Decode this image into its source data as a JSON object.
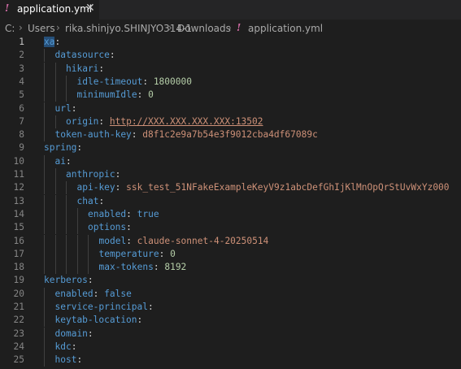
{
  "tab": {
    "icon": "yaml-icon",
    "label": "application.yml",
    "close": "✕"
  },
  "breadcrumb": {
    "items": [
      "C:",
      "Users",
      "rika.shinjyo.SHINJYO314-1",
      "Downloads"
    ],
    "file_icon": "!",
    "file": "application.yml"
  },
  "lines": [
    {
      "n": "1",
      "indent": 0,
      "key": "xa",
      "sep": ":",
      "val": "",
      "vt": ""
    },
    {
      "n": "2",
      "indent": 1,
      "key": "datasource",
      "sep": ":",
      "val": "",
      "vt": ""
    },
    {
      "n": "3",
      "indent": 2,
      "key": "hikari",
      "sep": ":",
      "val": "",
      "vt": ""
    },
    {
      "n": "4",
      "indent": 3,
      "key": "idle-timeout",
      "sep": ": ",
      "val": "1800000",
      "vt": "n"
    },
    {
      "n": "5",
      "indent": 3,
      "key": "minimumIdle",
      "sep": ": ",
      "val": "0",
      "vt": "n"
    },
    {
      "n": "6",
      "indent": 1,
      "key": "url",
      "sep": ":",
      "val": "",
      "vt": ""
    },
    {
      "n": "7",
      "indent": 2,
      "key": "origin",
      "sep": ": ",
      "val": "http://XXX.XXX.XXX.XXX:13502",
      "vt": "su"
    },
    {
      "n": "8",
      "indent": 1,
      "key": "token-auth-key",
      "sep": ": ",
      "val": "d8f1c2e9a7b54e3f9012cba4df67089c",
      "vt": "s"
    },
    {
      "n": "9",
      "indent": 0,
      "key": "spring",
      "sep": ":",
      "val": "",
      "vt": ""
    },
    {
      "n": "10",
      "indent": 1,
      "key": "ai",
      "sep": ":",
      "val": "",
      "vt": ""
    },
    {
      "n": "11",
      "indent": 2,
      "key": "anthropic",
      "sep": ":",
      "val": "",
      "vt": ""
    },
    {
      "n": "12",
      "indent": 3,
      "key": "api-key",
      "sep": ": ",
      "val": "ssk_test_51NFakeExampleKeyV9z1abcDefGhIjKlMnOpQrStUvWxYz000",
      "vt": "s"
    },
    {
      "n": "13",
      "indent": 3,
      "key": "chat",
      "sep": ":",
      "val": "",
      "vt": ""
    },
    {
      "n": "14",
      "indent": 4,
      "key": "enabled",
      "sep": ": ",
      "val": "true",
      "vt": "b"
    },
    {
      "n": "15",
      "indent": 4,
      "key": "options",
      "sep": ":",
      "val": "",
      "vt": ""
    },
    {
      "n": "16",
      "indent": 5,
      "key": "model",
      "sep": ": ",
      "val": "claude-sonnet-4-20250514",
      "vt": "s"
    },
    {
      "n": "17",
      "indent": 5,
      "key": "temperature",
      "sep": ": ",
      "val": "0",
      "vt": "n"
    },
    {
      "n": "18",
      "indent": 5,
      "key": "max-tokens",
      "sep": ": ",
      "val": "8192",
      "vt": "n"
    },
    {
      "n": "19",
      "indent": 0,
      "key": "kerberos",
      "sep": ":",
      "val": "",
      "vt": ""
    },
    {
      "n": "20",
      "indent": 1,
      "key": "enabled",
      "sep": ": ",
      "val": "false",
      "vt": "b"
    },
    {
      "n": "21",
      "indent": 1,
      "key": "service-principal",
      "sep": ":",
      "val": "",
      "vt": ""
    },
    {
      "n": "22",
      "indent": 1,
      "key": "keytab-location",
      "sep": ":",
      "val": "",
      "vt": ""
    },
    {
      "n": "23",
      "indent": 1,
      "key": "domain",
      "sep": ":",
      "val": "",
      "vt": ""
    },
    {
      "n": "24",
      "indent": 1,
      "key": "kdc",
      "sep": ":",
      "val": "",
      "vt": ""
    },
    {
      "n": "25",
      "indent": 1,
      "key": "host",
      "sep": ":",
      "val": "",
      "vt": ""
    }
  ]
}
